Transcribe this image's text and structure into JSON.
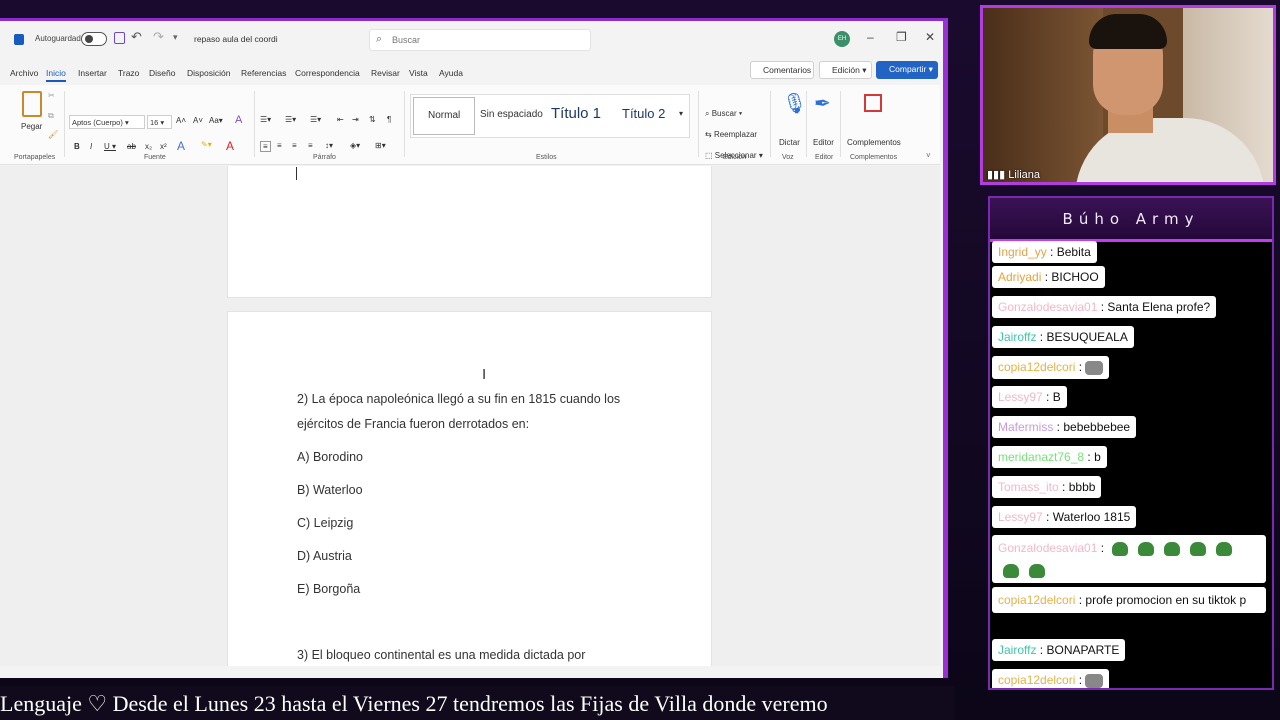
{
  "word": {
    "autosave_label": "Autoguardado",
    "doc_name": "repaso aula del coordi",
    "search_placeholder": "Buscar",
    "user_initials": "EH",
    "tabs": [
      "Archivo",
      "Inicio",
      "Insertar",
      "Trazo",
      "Diseño",
      "Disposición",
      "Referencias",
      "Correspondencia",
      "Revisar",
      "Vista",
      "Ayuda"
    ],
    "active_tab": "Inicio",
    "comentarios_label": "Comentarios",
    "edicion_label": "Edición",
    "compartir_label": "Compartir",
    "ribbon": {
      "pegar": "Pegar",
      "font_name": "Aptos (Cuerpo)",
      "font_size": "16",
      "style_normal": "Normal",
      "style_sin_espaciado": "Sin espaciado",
      "style_titulo1": "Título 1",
      "style_titulo2": "Título 2",
      "buscar": "Buscar",
      "reemplazar": "Reemplazar",
      "seleccionar": "Seleccionar",
      "dictar": "Dictar",
      "editor": "Editor",
      "complementos": "Complementos",
      "groups": {
        "portapapeles": "Portapapeles",
        "fuente": "Fuente",
        "parrafo": "Párrafo",
        "estilos": "Estilos",
        "edicion": "Edición",
        "voz": "Voz",
        "editor": "Editor",
        "complementos": "Complementos"
      }
    },
    "document": {
      "question2_line1": "2) La época napoleónica llegó a su fin en 1815 cuando los",
      "question2_line2": "ejércitos de Francia fueron derrotados en:",
      "options": [
        "A) Borodino",
        "B) Waterloo",
        "C) Leipzig",
        "D) Austria",
        "E) Borgoña"
      ],
      "question3_line1": "3) El bloqueo continental es una medida dictada por"
    }
  },
  "webcam": {
    "username": "Liliana"
  },
  "chat": {
    "title": "Búho Army",
    "colors": {
      "header_border": "#c23df0",
      "frame": "#b23ce0"
    },
    "messages": [
      {
        "user": "Ingrid_yy",
        "user_color": "#e4a24a",
        "text": "Bebita"
      },
      {
        "user": "Adriyadi",
        "user_color": "#e8a33a",
        "text": "BICHOO"
      },
      {
        "user": "Gonzalodesavia01",
        "user_color": "#f2b8c6",
        "text": "Santa Elena profe?"
      },
      {
        "user": "Jairoffz",
        "user_color": "#3fc6a8",
        "text": "BESUQUEALA"
      },
      {
        "user": "copia12delcori",
        "user_color": "#e4b248",
        "text": "",
        "emote": "cat-emote"
      },
      {
        "user": "Lessy97",
        "user_color": "#efb9c4",
        "text": "B"
      },
      {
        "user": "Mafermiss",
        "user_color": "#c79ae0",
        "text": "bebebbebee"
      },
      {
        "user": "meridanazt76_8",
        "user_color": "#78e07a",
        "text": "b"
      },
      {
        "user": "Tomass_ito",
        "user_color": "#f2b8c6",
        "text": "bbbb"
      },
      {
        "user": "Lessy97",
        "user_color": "#efb9c4",
        "text": "Waterloo 1815"
      },
      {
        "user": "Gonzalodesavia01",
        "user_color": "#f2b8c6",
        "text": "",
        "emote": "pepe-emote-row"
      },
      {
        "user": "copia12delcori",
        "user_color": "#e4b248",
        "text": "profe promocion en su tiktok p"
      },
      {
        "user": "Jairoffz",
        "user_color": "#3fc6a8",
        "text": "BONAPARTE"
      },
      {
        "user": "copia12delcori",
        "user_color": "#e4b248",
        "text": "",
        "emote": "cat-emote"
      }
    ]
  },
  "ticker": {
    "text": "Lenguaje    ♡    Desde el Lunes 23 hasta el Viernes 27 tendremos las Fijas de Villa donde veremo"
  }
}
